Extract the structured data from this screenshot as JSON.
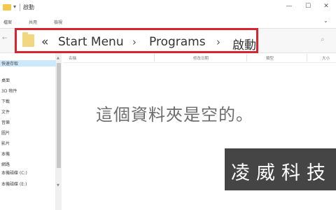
{
  "window": {
    "title": "啟動",
    "pin_glyph": "▾",
    "min_glyph": "—",
    "max_glyph": "☐",
    "close_glyph": "✕"
  },
  "ribbon": {
    "tabs": [
      "檔案",
      "共用",
      "檢視"
    ],
    "expand_glyph": "⌄"
  },
  "nav": {
    "back_glyph": "←",
    "search_glyph": "⌕"
  },
  "address": {
    "overflow": "«",
    "separator": "›",
    "crumbs": [
      "Start Menu",
      "Programs",
      "啟動"
    ]
  },
  "columns": [
    "名稱",
    "修改日期",
    "類型",
    "大小"
  ],
  "sidebar": {
    "items": [
      "快速存取",
      "桌面",
      "3D 物件",
      "下載",
      "文件",
      "音樂",
      "圖片",
      "影片",
      "本機",
      "網路",
      "本機磁碟 (C:)",
      "本機磁碟 (E:)"
    ],
    "selected_index": 0,
    "scroll_up": "▲",
    "scroll_down": "▼"
  },
  "content": {
    "empty_message": "這個資料夾是空的。"
  },
  "watermark": {
    "text": "凌威科技"
  }
}
